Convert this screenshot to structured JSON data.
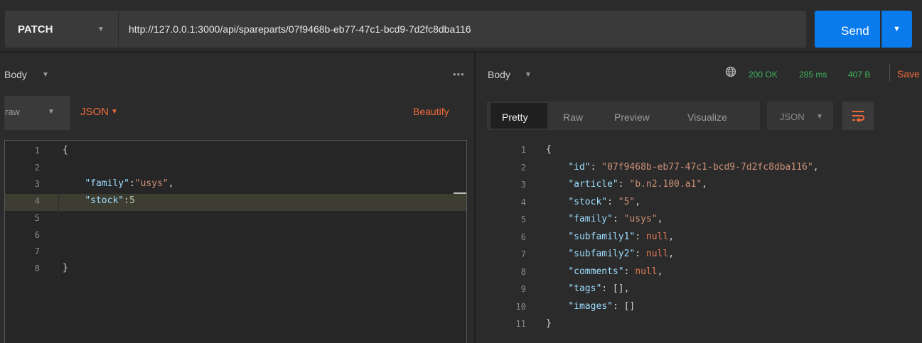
{
  "request": {
    "method": "PATCH",
    "url": "http://127.0.0.1:3000/api/spareparts/07f9468b-eb77-47c1-bcd9-7d2fc8dba116",
    "send_label": "Send"
  },
  "left": {
    "body_label": "Body",
    "more_label": "•••",
    "body_type": "raw",
    "format": "JSON",
    "beautify_label": "Beautify",
    "lines": [
      {
        "n": "1",
        "parts": [
          {
            "t": "{",
            "c": "pun"
          }
        ]
      },
      {
        "n": "2",
        "parts": []
      },
      {
        "n": "3",
        "parts": [
          {
            "t": "    ",
            "c": "pun"
          },
          {
            "t": "\"family\"",
            "c": "key"
          },
          {
            "t": ":",
            "c": "pun"
          },
          {
            "t": "\"usys\"",
            "c": "str"
          },
          {
            "t": ",",
            "c": "pun"
          }
        ]
      },
      {
        "n": "4",
        "parts": [
          {
            "t": "    ",
            "c": "pun"
          },
          {
            "t": "\"stock\"",
            "c": "key"
          },
          {
            "t": ":",
            "c": "pun"
          },
          {
            "t": "5",
            "c": "num"
          }
        ]
      },
      {
        "n": "5",
        "parts": []
      },
      {
        "n": "6",
        "parts": []
      },
      {
        "n": "7",
        "parts": []
      },
      {
        "n": "8",
        "parts": [
          {
            "t": "}",
            "c": "pun"
          }
        ]
      }
    ]
  },
  "right": {
    "body_label": "Body",
    "status": "200 OK",
    "time": "285 ms",
    "size": "407 B",
    "save_label": "Save",
    "tabs": [
      "Pretty",
      "Raw",
      "Preview",
      "Visualize"
    ],
    "active_tab": "Pretty",
    "format": "JSON",
    "lines": [
      {
        "n": "1",
        "parts": [
          {
            "t": "{",
            "c": "pun"
          }
        ]
      },
      {
        "n": "2",
        "parts": [
          {
            "t": "    ",
            "c": "pun"
          },
          {
            "t": "\"id\"",
            "c": "key"
          },
          {
            "t": ": ",
            "c": "pun"
          },
          {
            "t": "\"07f9468b-eb77-47c1-bcd9-7d2fc8dba116\"",
            "c": "str"
          },
          {
            "t": ",",
            "c": "pun"
          }
        ]
      },
      {
        "n": "3",
        "parts": [
          {
            "t": "    ",
            "c": "pun"
          },
          {
            "t": "\"article\"",
            "c": "key"
          },
          {
            "t": ": ",
            "c": "pun"
          },
          {
            "t": "\"b.n2.100.a1\"",
            "c": "str"
          },
          {
            "t": ",",
            "c": "pun"
          }
        ]
      },
      {
        "n": "4",
        "parts": [
          {
            "t": "    ",
            "c": "pun"
          },
          {
            "t": "\"stock\"",
            "c": "key"
          },
          {
            "t": ": ",
            "c": "pun"
          },
          {
            "t": "\"5\"",
            "c": "str"
          },
          {
            "t": ",",
            "c": "pun"
          }
        ]
      },
      {
        "n": "5",
        "parts": [
          {
            "t": "    ",
            "c": "pun"
          },
          {
            "t": "\"family\"",
            "c": "key"
          },
          {
            "t": ": ",
            "c": "pun"
          },
          {
            "t": "\"usys\"",
            "c": "str"
          },
          {
            "t": ",",
            "c": "pun"
          }
        ]
      },
      {
        "n": "6",
        "parts": [
          {
            "t": "    ",
            "c": "pun"
          },
          {
            "t": "\"subfamily1\"",
            "c": "key"
          },
          {
            "t": ": ",
            "c": "pun"
          },
          {
            "t": "null",
            "c": "nul"
          },
          {
            "t": ",",
            "c": "pun"
          }
        ]
      },
      {
        "n": "7",
        "parts": [
          {
            "t": "    ",
            "c": "pun"
          },
          {
            "t": "\"subfamily2\"",
            "c": "key"
          },
          {
            "t": ": ",
            "c": "pun"
          },
          {
            "t": "null",
            "c": "nul"
          },
          {
            "t": ",",
            "c": "pun"
          }
        ]
      },
      {
        "n": "8",
        "parts": [
          {
            "t": "    ",
            "c": "pun"
          },
          {
            "t": "\"comments\"",
            "c": "key"
          },
          {
            "t": ": ",
            "c": "pun"
          },
          {
            "t": "null",
            "c": "nul"
          },
          {
            "t": ",",
            "c": "pun"
          }
        ]
      },
      {
        "n": "9",
        "parts": [
          {
            "t": "    ",
            "c": "pun"
          },
          {
            "t": "\"tags\"",
            "c": "key"
          },
          {
            "t": ": [],",
            "c": "pun"
          }
        ]
      },
      {
        "n": "10",
        "parts": [
          {
            "t": "    ",
            "c": "pun"
          },
          {
            "t": "\"images\"",
            "c": "key"
          },
          {
            "t": ": []",
            "c": "pun"
          }
        ]
      },
      {
        "n": "11",
        "parts": [
          {
            "t": "}",
            "c": "pun"
          }
        ]
      }
    ]
  },
  "colors": {
    "accent": "#097bed",
    "orange": "#ee6a3a",
    "status_green": "#3eb45a"
  },
  "icons": {
    "caret": "chevron-down-icon",
    "globe": "globe-icon",
    "wrap": "wrap-lines-icon"
  }
}
